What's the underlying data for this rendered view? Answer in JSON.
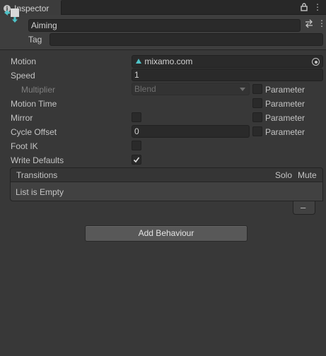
{
  "tab": {
    "title": "Inspector",
    "info_icon": "i",
    "menu_icon": "⋮"
  },
  "header": {
    "name": "Aiming",
    "tag_label": "Tag",
    "tag_value": "",
    "menu_icon": "⋮",
    "preset_icon": "⇄"
  },
  "properties": {
    "motion": {
      "label": "Motion",
      "value": "mixamo.com"
    },
    "speed": {
      "label": "Speed",
      "value": "1"
    },
    "multiplier": {
      "label": "Multiplier",
      "value": "Blend",
      "param_label": "Parameter"
    },
    "motion_time": {
      "label": "Motion Time",
      "param_label": "Parameter"
    },
    "mirror": {
      "label": "Mirror",
      "param_label": "Parameter"
    },
    "cycle_offset": {
      "label": "Cycle Offset",
      "value": "0",
      "param_label": "Parameter"
    },
    "foot_ik": {
      "label": "Foot IK",
      "checked": false
    },
    "write_defaults": {
      "label": "Write Defaults",
      "checked": true
    }
  },
  "transitions": {
    "header": "Transitions",
    "solo": "Solo",
    "mute": "Mute",
    "empty_text": "List is Empty",
    "remove_label": "–"
  },
  "add_behaviour_label": "Add Behaviour",
  "colors": {
    "background": "#383838",
    "header": "#3e3e3e",
    "field": "#2a2a2a",
    "accent": "#4fc3c8"
  }
}
